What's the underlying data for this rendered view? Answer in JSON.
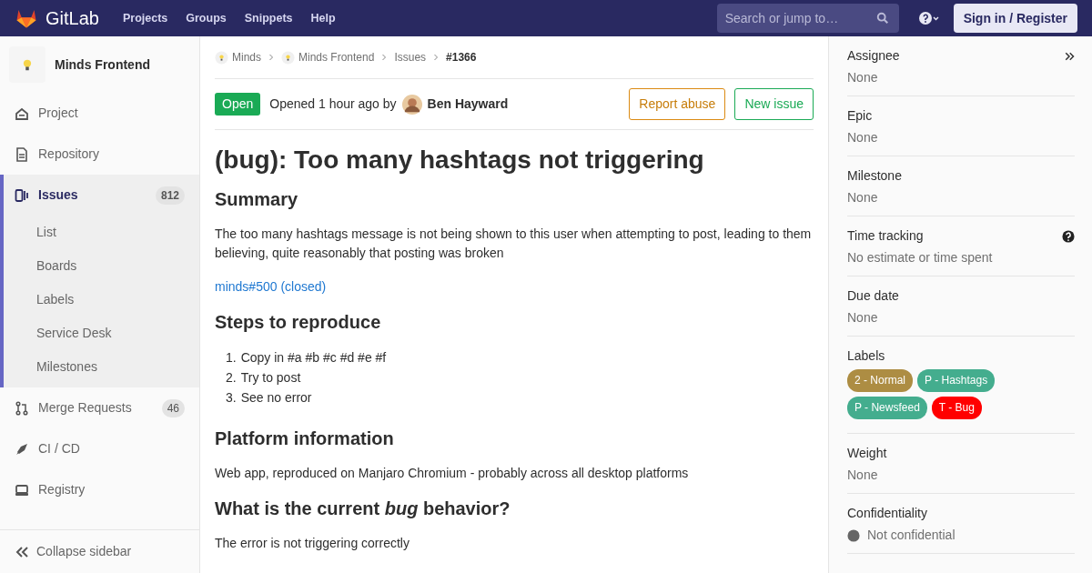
{
  "topbar": {
    "brand": "GitLab",
    "nav": [
      "Projects",
      "Groups",
      "Snippets",
      "Help"
    ],
    "search": {
      "placeholder": "Search or jump to…"
    },
    "sign_in": "Sign in / Register"
  },
  "sidebar": {
    "project": "Minds Frontend",
    "items": [
      {
        "label": "Project",
        "selected": false
      },
      {
        "label": "Repository",
        "selected": false
      },
      {
        "label": "Issues",
        "count": "812",
        "selected": true,
        "children": [
          {
            "label": "List"
          },
          {
            "label": "Boards"
          },
          {
            "label": "Labels"
          },
          {
            "label": "Service Desk"
          },
          {
            "label": "Milestones"
          }
        ]
      },
      {
        "label": "Merge Requests",
        "count": "46",
        "selected": false
      },
      {
        "label": "CI / CD",
        "selected": false
      },
      {
        "label": "Registry",
        "selected": false
      }
    ],
    "collapse": "Collapse sidebar"
  },
  "breadcrumbs": [
    "Minds",
    "Minds Frontend",
    "Issues",
    "#1366"
  ],
  "issue": {
    "status": "Open",
    "opened": "Opened 1 hour ago by",
    "author": "Ben Hayward",
    "buttons": [
      "Report abuse",
      "New issue"
    ],
    "title": "(bug): Too many hashtags not triggering",
    "body": [
      {
        "kind": "h",
        "text": "Summary"
      },
      {
        "kind": "p",
        "text": "The too many hashtags message is not being shown to this user when attempting to post, leading to them believing, quite reasonably that posting was broken"
      },
      {
        "kind": "link",
        "text": "minds#500 (closed)"
      },
      {
        "kind": "h",
        "text": "Steps to reproduce"
      },
      {
        "kind": "ol",
        "items": [
          {
            "marker": "1.",
            "text": "Copy in #a #b #c #d #e #f"
          },
          {
            "marker": "2.",
            "text": "Try to post"
          },
          {
            "marker": "3.",
            "text": "See no error"
          }
        ]
      },
      {
        "kind": "h",
        "text": "Platform information"
      },
      {
        "kind": "p",
        "text": "Web app, reproduced on Manjaro Chromium - probably across all desktop platforms"
      },
      {
        "kind": "h",
        "text": "What is the current *bug* behavior?"
      },
      {
        "kind": "p",
        "text": "The error is not triggering correctly"
      }
    ]
  },
  "right": {
    "blocks": [
      {
        "title": "Assignee",
        "value": "None"
      },
      {
        "title": "Epic",
        "value": "None"
      },
      {
        "title": "Milestone",
        "value": "None"
      },
      {
        "title": "Time tracking",
        "value": "No estimate or time spent"
      },
      {
        "title": "Due date",
        "value": "None"
      },
      {
        "title": "Labels",
        "labels": [
          {
            "text": "2 - Normal",
            "color": "#ad8d43"
          },
          {
            "text": "P - Hashtags",
            "color": "#44ad8e"
          },
          {
            "text": "P - Newsfeed",
            "color": "#44ad8e"
          },
          {
            "text": "T - Bug",
            "color": "#ff0000"
          }
        ]
      },
      {
        "title": "Weight",
        "value": "None"
      },
      {
        "title": "Confidentiality",
        "value": "Not confidential"
      }
    ]
  }
}
